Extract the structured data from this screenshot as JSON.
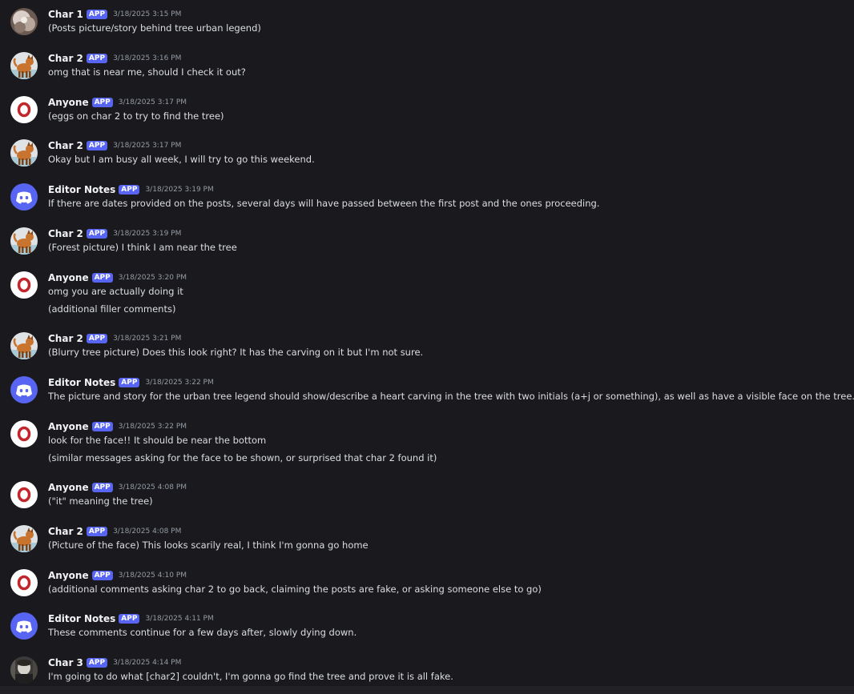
{
  "messages": [
    {
      "author": "Char 1",
      "badge": "APP",
      "timestamp": "3/18/2025 3:15 PM",
      "avatar": "char1",
      "lines": [
        "(Posts picture/story behind tree urban legend)"
      ]
    },
    {
      "author": "Char 2",
      "badge": "APP",
      "timestamp": "3/18/2025 3:16 PM",
      "avatar": "char2",
      "lines": [
        "omg that is near me, should I check it out?"
      ]
    },
    {
      "author": "Anyone",
      "badge": "APP",
      "timestamp": "3/18/2025 3:17 PM",
      "avatar": "anyone",
      "lines": [
        "(eggs on char 2 to try to find the tree)"
      ]
    },
    {
      "author": "Char 2",
      "badge": "APP",
      "timestamp": "3/18/2025 3:17 PM",
      "avatar": "char2",
      "lines": [
        "Okay but I am busy all week, I will try to go this weekend."
      ]
    },
    {
      "author": "Editor Notes",
      "badge": "APP",
      "timestamp": "3/18/2025 3:19 PM",
      "avatar": "editor",
      "lines": [
        "If there are dates provided on the posts, several days will have passed between the first post and the ones proceeding."
      ]
    },
    {
      "author": "Char 2",
      "badge": "APP",
      "timestamp": "3/18/2025 3:19 PM",
      "avatar": "char2",
      "lines": [
        "(Forest picture) I think I am near the tree"
      ]
    },
    {
      "author": "Anyone",
      "badge": "APP",
      "timestamp": "3/18/2025 3:20 PM",
      "avatar": "anyone",
      "lines": [
        "omg you are actually doing it",
        "(additional filler comments)"
      ]
    },
    {
      "author": "Char 2",
      "badge": "APP",
      "timestamp": "3/18/2025 3:21 PM",
      "avatar": "char2",
      "lines": [
        "(Blurry tree picture) Does this look right? It has the carving on it but I'm not sure."
      ]
    },
    {
      "author": "Editor Notes",
      "badge": "APP",
      "timestamp": "3/18/2025 3:22 PM",
      "avatar": "editor",
      "lines": [
        "The picture and story for the urban tree legend should show/describe a heart carving in the tree with two initials (a+j or something), as well as have a visible face on the tree."
      ]
    },
    {
      "author": "Anyone",
      "badge": "APP",
      "timestamp": "3/18/2025 3:22 PM",
      "avatar": "anyone",
      "lines": [
        "look for the face!! It should be near the bottom",
        "(similar messages asking for the face to be shown, or surprised that char 2 found it)"
      ]
    },
    {
      "author": "Anyone",
      "badge": "APP",
      "timestamp": "3/18/2025 4:08 PM",
      "avatar": "anyone",
      "lines": [
        "(\"it\" meaning the tree)"
      ]
    },
    {
      "author": "Char 2",
      "badge": "APP",
      "timestamp": "3/18/2025 4:08 PM",
      "avatar": "char2",
      "lines": [
        "(Picture of the face) This looks scarily real, I think I'm gonna go home"
      ]
    },
    {
      "author": "Anyone",
      "badge": "APP",
      "timestamp": "3/18/2025 4:10 PM",
      "avatar": "anyone",
      "lines": [
        "(additional comments asking char 2 to go back, claiming the posts are fake, or asking someone else to go)"
      ]
    },
    {
      "author": "Editor Notes",
      "badge": "APP",
      "timestamp": "3/18/2025 4:11 PM",
      "avatar": "editor",
      "lines": [
        "These comments continue for a few days after, slowly dying down."
      ]
    },
    {
      "author": "Char 3",
      "badge": "APP",
      "timestamp": "3/18/2025 4:14 PM",
      "avatar": "char3",
      "lines": [
        "I'm going to do what [char2] couldn't, I'm gonna go find the tree and prove it is all fake."
      ]
    }
  ],
  "colors": {
    "background": "#1a1a1e",
    "badge": "#5865f2",
    "author": "#f2f3f5",
    "text": "#dbdee1",
    "timestamp": "#949ba4",
    "discord_blurple": "#5865f2",
    "anyone_ring": "#c0262b"
  }
}
